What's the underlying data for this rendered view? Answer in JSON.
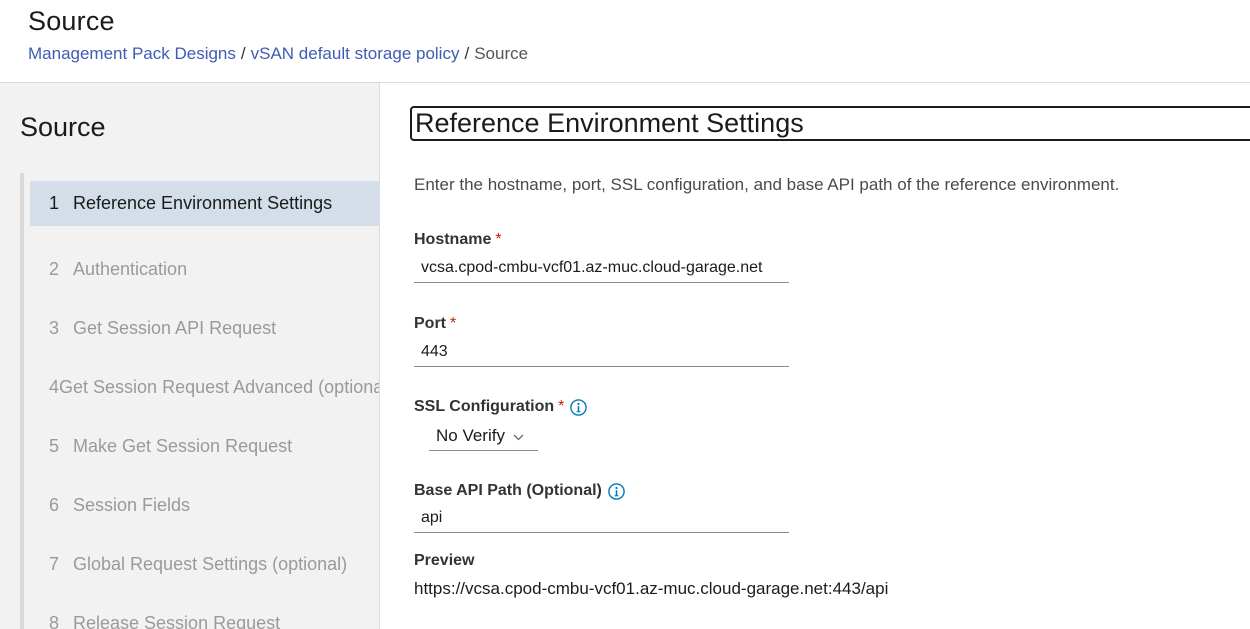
{
  "header": {
    "title": "Source",
    "breadcrumb": {
      "items": [
        "Management Pack Designs",
        "vSAN default storage policy"
      ],
      "separator": "/",
      "current": "Source"
    }
  },
  "sidebar": {
    "title": "Source",
    "steps": [
      {
        "number": "1",
        "label": "Reference Environment Settings"
      },
      {
        "number": "2",
        "label": "Authentication"
      },
      {
        "number": "3",
        "label": "Get Session API Request"
      },
      {
        "number": "4",
        "label": "Get Session Request Advanced (optional)"
      },
      {
        "number": "5",
        "label": "Make Get Session Request"
      },
      {
        "number": "6",
        "label": "Session Fields"
      },
      {
        "number": "7",
        "label": "Global Request Settings (optional)"
      },
      {
        "number": "8",
        "label": "Release Session Request"
      }
    ]
  },
  "main": {
    "heading": "Reference Environment Settings",
    "description": "Enter the hostname, port, SSL configuration, and base API path of the reference environment.",
    "hostname": {
      "label": "Hostname",
      "required_mark": "*",
      "value": "vcsa.cpod-cmbu-vcf01.az-muc.cloud-garage.net"
    },
    "port": {
      "label": "Port",
      "required_mark": "*",
      "value": "443"
    },
    "ssl": {
      "label": "SSL Configuration",
      "required_mark": "*",
      "selected": "No Verify",
      "icon": "info-icon"
    },
    "base_api": {
      "label": "Base API Path (Optional)",
      "value": "api",
      "icon": "info-icon"
    },
    "preview": {
      "label": "Preview",
      "value": "https://vcsa.cpod-cmbu-vcf01.az-muc.cloud-garage.net:443/api"
    }
  },
  "colors": {
    "link": "#3f5bb5",
    "required": "#c92100",
    "active_step_bg": "#d3dee8",
    "info_icon": "#0079b8"
  }
}
